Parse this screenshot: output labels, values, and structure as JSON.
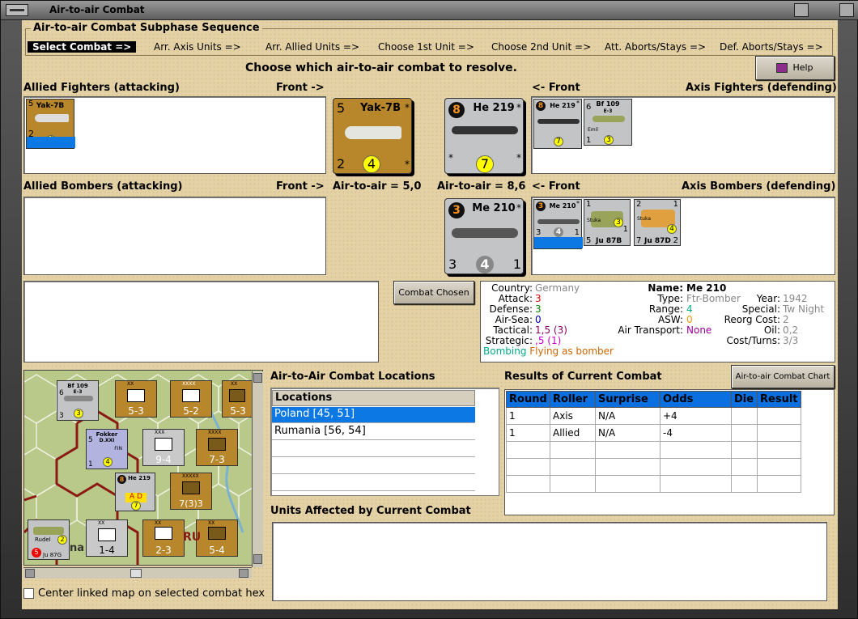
{
  "window": {
    "title": "Air-to-air Combat"
  },
  "sequence": {
    "title": "Air-to-air Combat Subphase Sequence",
    "steps": [
      "Select Combat =>",
      "Arr. Axis Units =>",
      "Arr. Allied Units =>",
      "Choose 1st Unit =>",
      "Choose 2nd Unit =>",
      "Att. Aborts/Stays =>",
      "Def. Aborts/Stays =>"
    ]
  },
  "prompt": "Choose which air-to-air combat to resolve.",
  "help_label": "Help",
  "panels": {
    "allied_fighters": "Allied Fighters (attacking)",
    "front_right_1": "Front ->",
    "front_left_1": "<- Front",
    "axis_fighters": "Axis Fighters (defending)",
    "allied_bombers": "Allied Bombers (attacking)",
    "front_right_2": "Front ->",
    "air_to_air_allied": "Air-to-air = 5,0",
    "air_to_air_axis": "Air-to-air = 8,6",
    "front_left_2": "<- Front",
    "axis_bombers": "Axis Bombers (defending)"
  },
  "units": {
    "yak": {
      "name": "Yak-7B",
      "top": "5",
      "bottom_left": "2",
      "circle": "4",
      "star": "*"
    },
    "he219": {
      "name": "He 219",
      "badge": "8",
      "circle": "7",
      "star": "*"
    },
    "bf109": {
      "name": "Bf 109",
      "sub": "E-3",
      "nick": "Emil",
      "top": "6",
      "bottom_left": "1",
      "circle": "3",
      "star": "*"
    },
    "me210": {
      "name": "Me 210",
      "badge": "3",
      "bottom_left": "3",
      "circle": "4",
      "bottom_right": "1",
      "star": "*"
    },
    "ju87b": {
      "name": "Ju 87B",
      "top": "1",
      "bottom_left": "5",
      "circle": "3",
      "bottom_right": "1",
      "nick": "Stuka"
    },
    "ju87d": {
      "name": "Ju 87D",
      "top": "2",
      "bottom_left": "7",
      "circle": "4",
      "bottom_right": "2",
      "top_right": "1",
      "nick": "Stuka"
    }
  },
  "combat_chosen_label": "Combat Chosen",
  "details": {
    "country_l": "Country:",
    "country_v": "Germany",
    "attack_l": "Attack:",
    "attack_v": "3",
    "defense_l": "Defense:",
    "defense_v": "3",
    "airsea_l": "Air-Sea:",
    "airsea_v": "0",
    "tactical_l": "Tactical:",
    "tactical_v": "1,5 (3)",
    "strategic_l": "Strategic:",
    "strategic_v": ",5 (1)",
    "bombing": "Bombing",
    "flying": "Flying as bomber",
    "name_l": "Name:",
    "name_v": "Me 210",
    "type_l": "Type:",
    "type_v": "Ftr-Bomber",
    "range_l": "Range:",
    "range_v": "4",
    "asw_l": "ASW:",
    "asw_v": "0",
    "airtrans_l": "Air Transport:",
    "airtrans_v": "None",
    "year_l": "Year:",
    "year_v": "1942",
    "special_l": "Special:",
    "special_v": "Tw Night",
    "reorg_l": "Reorg Cost:",
    "reorg_v": "2",
    "oil_l": "Oil:",
    "oil_v": "0,2",
    "cost_l": "Cost/Turns:",
    "cost_v": "3/3"
  },
  "locations": {
    "title": "Air-to-Air Combat Locations",
    "header": "Locations",
    "items": [
      "Poland [45, 51]",
      "Rumania [56, 54]"
    ],
    "selected": 0
  },
  "results": {
    "title": "Results of Current Combat",
    "chart_button": "Air-to-air Combat Chart",
    "columns": [
      "Round",
      "Roller",
      "Surprise",
      "Odds",
      "Die",
      "Result"
    ],
    "rows": [
      [
        "1",
        "Axis",
        "N/A",
        "+4",
        "",
        ""
      ],
      [
        "1",
        "Allied",
        "N/A",
        "-4",
        "",
        ""
      ]
    ]
  },
  "affected_title": "Units Affected by Current Combat",
  "center_map_label": "Center linked map on selected combat hex",
  "map": {
    "bf109": {
      "name": "Bf 109",
      "sub": "E-3",
      "top": "6",
      "bl": "3",
      "c": "3"
    },
    "fokker": {
      "name": "Fokker",
      "sub": "D.XXI",
      "top": "5",
      "bl": "1",
      "c": "4",
      "tag": "FIN"
    },
    "he219": {
      "badge": "8",
      "name": "He 219",
      "c": "7",
      "ad": "A D"
    },
    "rudel": {
      "name": "Rudel",
      "sub": "Ju 87G",
      "badge": "5",
      "c": "2"
    },
    "inf1": {
      "v": "5-3",
      "lbl": "XX"
    },
    "inf2": {
      "v": "5-2",
      "lbl": "XXXX"
    },
    "inf3": {
      "v": "5-3",
      "lbl": "XX"
    },
    "inf4": {
      "v": "9-4",
      "lbl": "XXX"
    },
    "inf5": {
      "v": "7-3",
      "lbl": "XXXX"
    },
    "inf6": {
      "v": "7(3)3",
      "lbl": "XXXXX"
    },
    "inf7": {
      "v": "1-4",
      "lbl": "XX"
    },
    "inf8": {
      "v": "2-3",
      "lbl": "XX"
    },
    "inf9": {
      "v": "5-4",
      "lbl": "XX"
    },
    "region": "RU",
    "region2": "na"
  }
}
